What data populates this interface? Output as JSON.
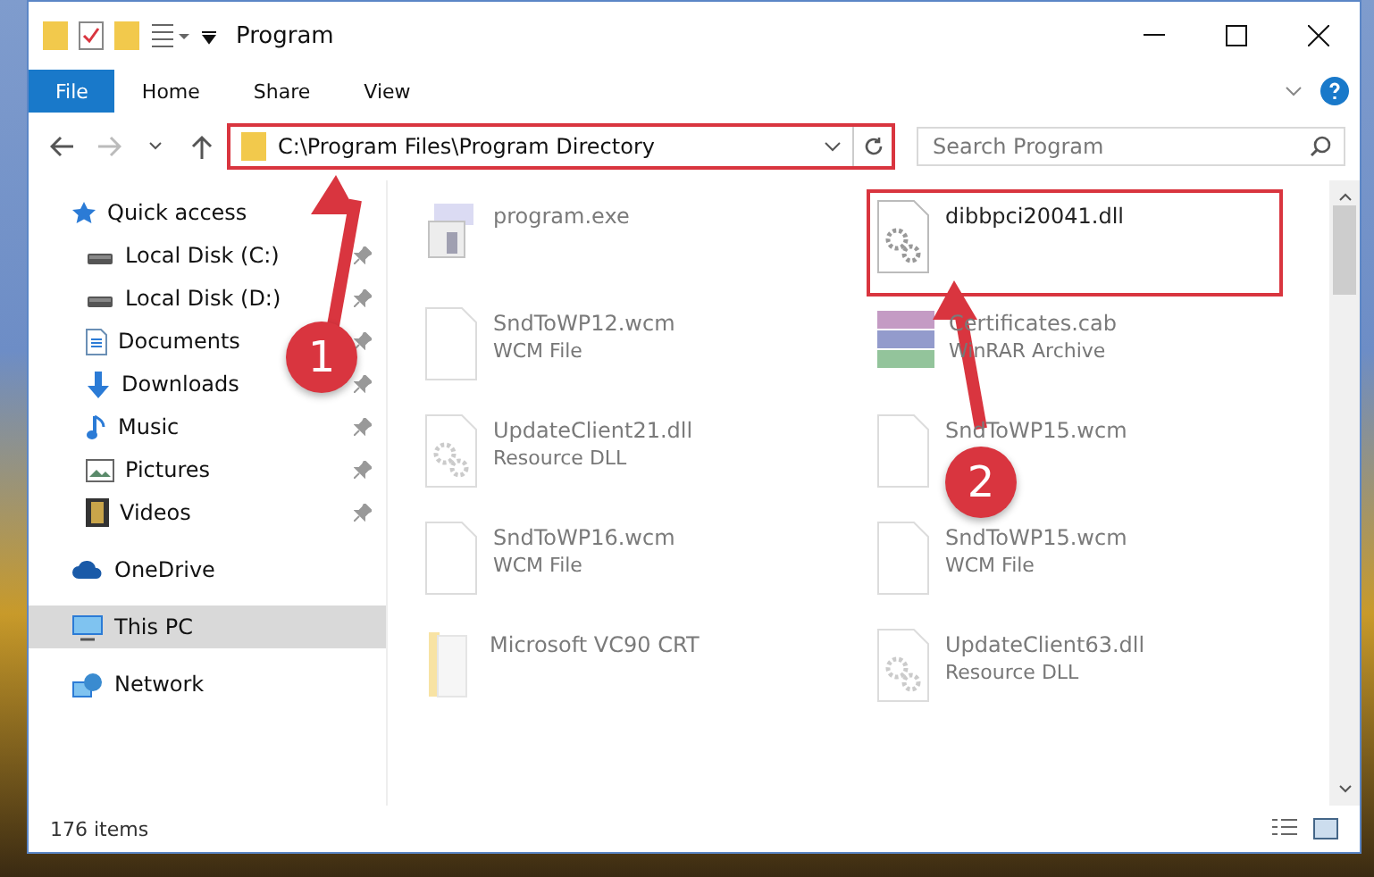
{
  "window": {
    "title": "Program"
  },
  "ribbon": {
    "tabs": [
      {
        "label": "File",
        "selected": true
      },
      {
        "label": "Home",
        "selected": false
      },
      {
        "label": "Share",
        "selected": false
      },
      {
        "label": "View",
        "selected": false
      }
    ]
  },
  "address": {
    "path": "C:\\Program Files\\Program Directory",
    "highlighted": true
  },
  "search": {
    "placeholder": "Search Program"
  },
  "sidebar": {
    "items": [
      {
        "label": "Quick access",
        "kind": "star",
        "selected": false,
        "children": [
          {
            "label": "Local Disk (C:)",
            "kind": "drive",
            "pinned": true,
            "selected": false
          },
          {
            "label": "Local Disk (D:)",
            "kind": "drive",
            "pinned": true,
            "selected": false
          },
          {
            "label": "Documents",
            "kind": "docs",
            "pinned": true,
            "selected": false
          },
          {
            "label": "Downloads",
            "kind": "download",
            "pinned": true,
            "selected": false
          },
          {
            "label": "Music",
            "kind": "music",
            "pinned": true,
            "selected": false
          },
          {
            "label": "Pictures",
            "kind": "pictures",
            "pinned": true,
            "selected": false
          },
          {
            "label": "Videos",
            "kind": "videos",
            "pinned": true,
            "selected": false
          }
        ]
      },
      {
        "label": "OneDrive",
        "kind": "cloud",
        "selected": false
      },
      {
        "label": "This PC",
        "kind": "pc",
        "selected": true
      },
      {
        "label": "Network",
        "kind": "network",
        "selected": false
      }
    ]
  },
  "files": [
    {
      "name": "program.exe",
      "kind": "exe",
      "blurred": true,
      "highlighted": false
    },
    {
      "name": "dibbpci20041.dll",
      "kind": "dll",
      "blurred": false,
      "highlighted": true
    },
    {
      "name": "SndToWP12.wcm",
      "type": "WCM File",
      "kind": "blank",
      "blurred": true,
      "highlighted": false
    },
    {
      "name": "Certificates.cab",
      "type": "WinRAR Archive",
      "kind": "archive",
      "blurred": true,
      "highlighted": false
    },
    {
      "name": "UpdateClient21.dll",
      "type": "Resource DLL",
      "kind": "dll",
      "blurred": true,
      "highlighted": false
    },
    {
      "name": "SndToWP15.wcm",
      "kind": "blank",
      "blurred": true,
      "highlighted": false
    },
    {
      "name": "SndToWP16.wcm",
      "type": "WCM File",
      "kind": "blank",
      "blurred": true,
      "highlighted": false
    },
    {
      "name": "SndToWP15.wcm",
      "type": "WCM File",
      "kind": "blank",
      "blurred": true,
      "highlighted": false
    },
    {
      "name": "Microsoft VC90 CRT",
      "kind": "folder",
      "blurred": true,
      "highlighted": false
    },
    {
      "name": "UpdateClient63.dll",
      "type": "Resource DLL",
      "kind": "dll",
      "blurred": true,
      "highlighted": false
    }
  ],
  "callouts": [
    {
      "number": "1"
    },
    {
      "number": "2"
    }
  ],
  "status_bar": {
    "count": "176 items"
  }
}
